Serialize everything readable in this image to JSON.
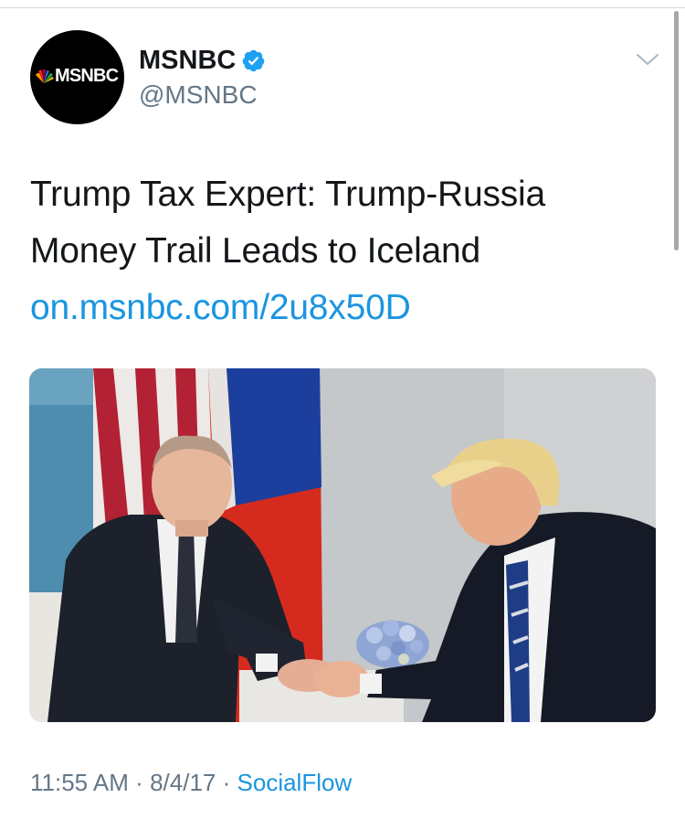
{
  "tweet": {
    "avatar": {
      "logo_text": "MSNBC",
      "icon": "nbc-peacock-icon"
    },
    "author": {
      "display_name": "MSNBC",
      "handle": "@MSNBC",
      "verified": true,
      "verified_icon": "verified-badge-icon"
    },
    "menu_icon": "chevron-down-icon",
    "text_lines": [
      "Trump Tax Expert: Trump-Russia",
      "Money Trail Leads to Iceland"
    ],
    "link": "on.msnbc.com/2u8x50D",
    "media": {
      "type": "photo",
      "icon": "photo-handshake"
    },
    "meta": {
      "time": "11:55 AM",
      "date": "8/4/17",
      "separator": "·",
      "source": "SocialFlow"
    }
  },
  "colors": {
    "link": "#1b95e0",
    "verified": "#1da1f2",
    "secondary_text": "#657786",
    "primary_text": "#14171a"
  }
}
